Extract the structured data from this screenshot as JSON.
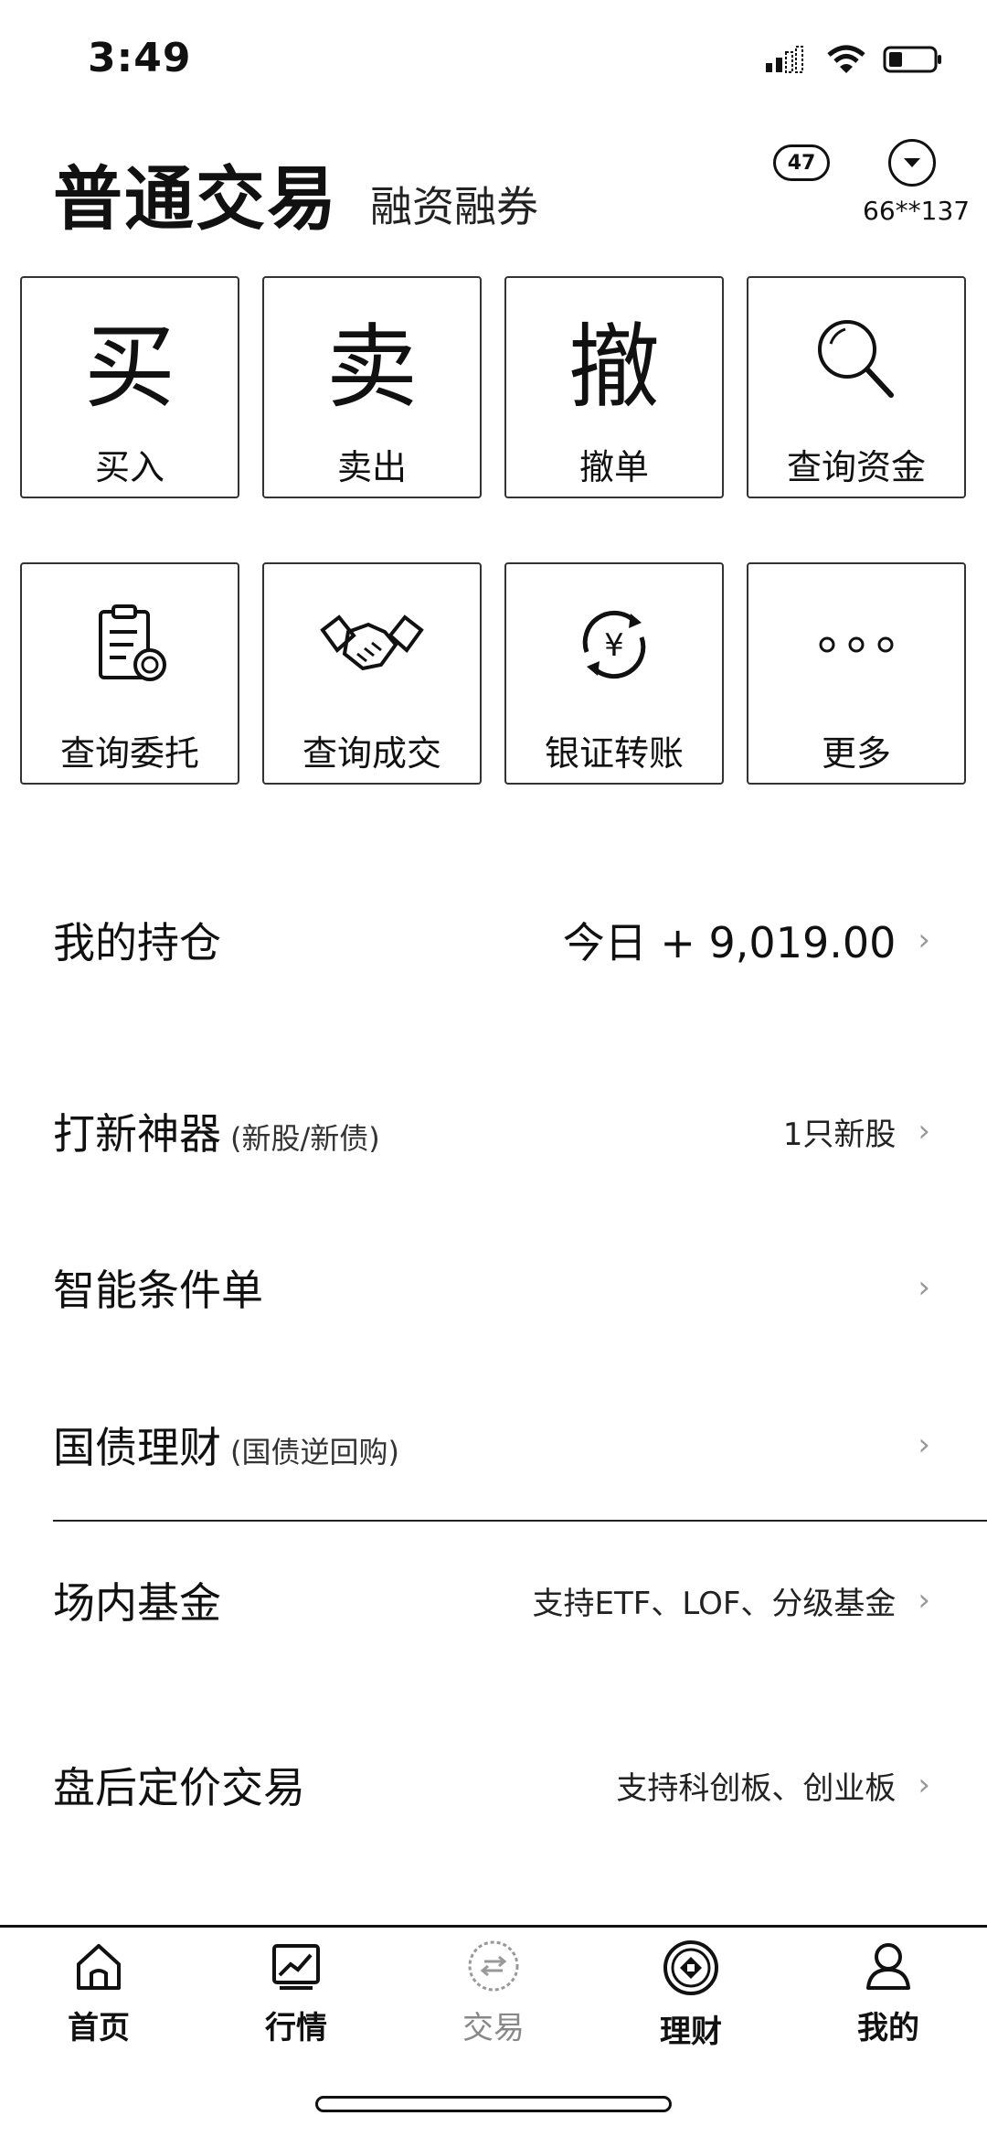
{
  "status": {
    "time": "3:49"
  },
  "header": {
    "title": "普通交易",
    "subtitle": "融资融券",
    "badge": "47",
    "account": "66**137"
  },
  "grid": [
    {
      "glyph": "买",
      "label": "买入"
    },
    {
      "glyph": "卖",
      "label": "卖出"
    },
    {
      "glyph": "撤",
      "label": "撤单"
    },
    {
      "icon": "search-icon",
      "label": "查询资金"
    },
    {
      "icon": "clipboard-icon",
      "label": "查询委托"
    },
    {
      "icon": "handshake-icon",
      "label": "查询成交"
    },
    {
      "icon": "yuan-transfer-icon",
      "label": "银证转账"
    },
    {
      "icon": "more-dots-icon",
      "label": "更多"
    }
  ],
  "rows": {
    "holdings": {
      "title": "我的持仓",
      "value": "今日 + 9,019.00"
    },
    "ipo": {
      "title": "打新神器",
      "sub": "(新股/新债)",
      "value": "1只新股"
    },
    "smart_order": {
      "title": "智能条件单"
    },
    "repo": {
      "title": "国债理财",
      "sub": "(国债逆回购)"
    },
    "fund": {
      "title": "场内基金",
      "value": "支持ETF、LOF、分级基金"
    },
    "after_hours": {
      "title": "盘后定价交易",
      "value": "支持科创板、创业板"
    }
  },
  "tabs": [
    {
      "icon": "home-icon",
      "label": "首页"
    },
    {
      "icon": "chart-icon",
      "label": "行情"
    },
    {
      "icon": "trade-icon",
      "label": "交易"
    },
    {
      "icon": "finance-icon",
      "label": "理财"
    },
    {
      "icon": "profile-icon",
      "label": "我的"
    }
  ]
}
